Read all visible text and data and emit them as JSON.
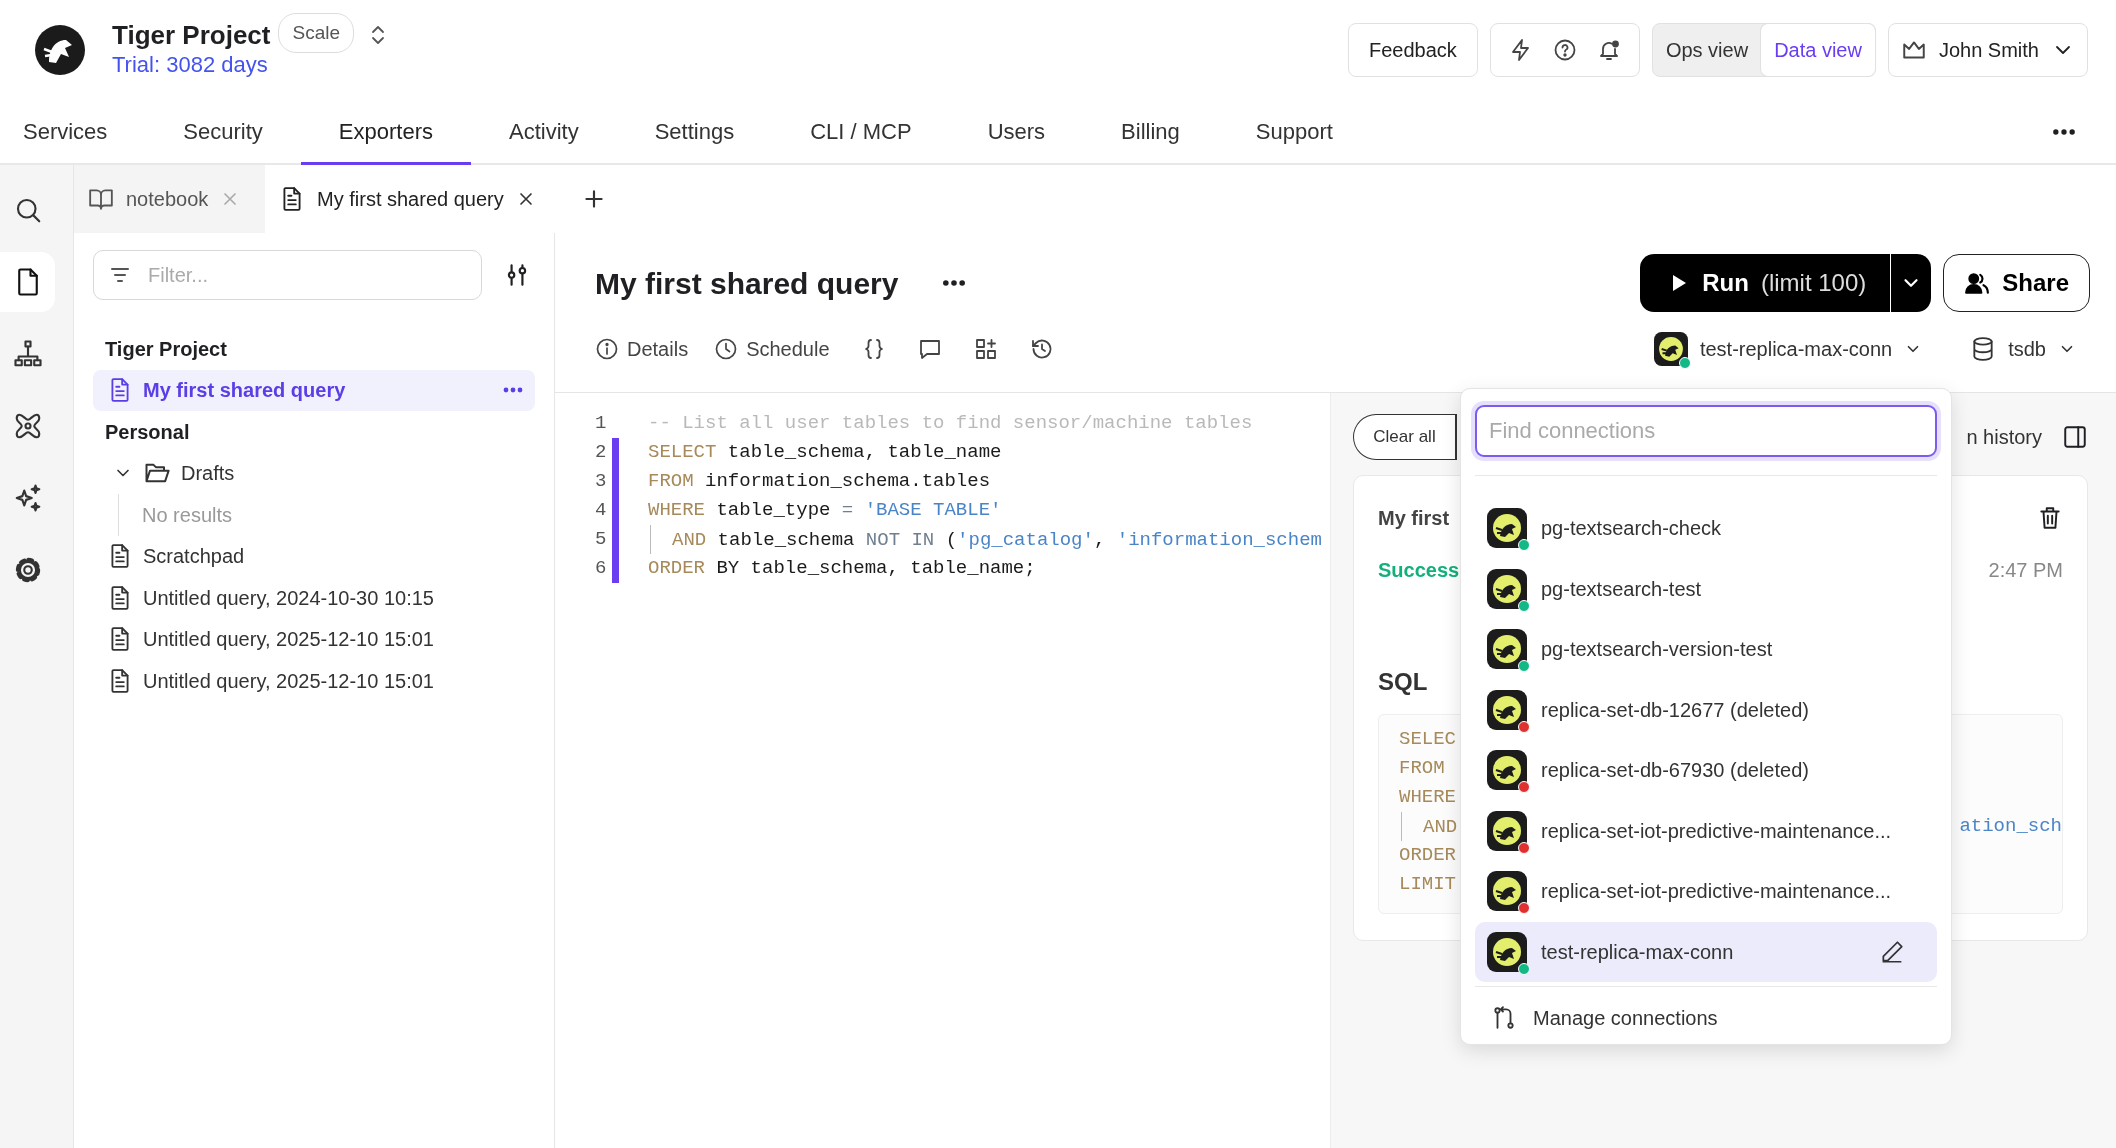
{
  "header": {
    "project": "Tiger Project",
    "trial": "Trial: 3082 days",
    "plan": "Scale",
    "feedback": "Feedback",
    "views": [
      {
        "label": "Ops view",
        "selected": false
      },
      {
        "label": "Data view",
        "selected": true
      }
    ],
    "user": "John Smith"
  },
  "nav": [
    {
      "label": "Services",
      "selected": false
    },
    {
      "label": "Security",
      "selected": false
    },
    {
      "label": "Exporters",
      "selected": true
    },
    {
      "label": "Activity",
      "selected": false
    },
    {
      "label": "Settings",
      "selected": false
    },
    {
      "label": "CLI / MCP",
      "selected": false
    },
    {
      "label": "Users",
      "selected": false
    },
    {
      "label": "Billing",
      "selected": false
    },
    {
      "label": "Support",
      "selected": false
    }
  ],
  "rail": [
    {
      "kind": "search",
      "selected": false
    },
    {
      "kind": "file",
      "selected": true
    },
    {
      "kind": "sitemap",
      "selected": false
    },
    {
      "kind": "atom",
      "selected": false
    },
    {
      "kind": "sparkles",
      "selected": false
    },
    {
      "kind": "gear",
      "selected": false
    }
  ],
  "tabs": [
    {
      "kind": "notebook",
      "label": "notebook",
      "selected": false
    },
    {
      "kind": "query",
      "label": "My first shared query",
      "selected": true
    }
  ],
  "sidebar": {
    "placeholder": "Filter...",
    "sections": [
      {
        "title": "Tiger Project",
        "items": [
          {
            "kind": "file",
            "label": "My first shared query",
            "selected": true
          }
        ]
      },
      {
        "title": "Personal",
        "items": [
          {
            "kind": "folder",
            "label": "Drafts",
            "expanded": true,
            "selected": false,
            "children": [
              {
                "kind": "empty",
                "label": "No results"
              }
            ]
          },
          {
            "kind": "file",
            "label": "Scratchpad",
            "selected": false
          },
          {
            "kind": "file",
            "label": "Untitled query, 2024-10-30 10:15",
            "selected": false
          },
          {
            "kind": "file",
            "label": "Untitled query, 2025-12-10 15:01",
            "selected": false
          },
          {
            "kind": "file",
            "label": "Untitled query, 2025-12-10 15:01",
            "selected": false
          }
        ]
      }
    ]
  },
  "query": {
    "title": "My first shared query",
    "run": "Run",
    "limit": "(limit 100)",
    "share": "Share",
    "toolbar": [
      {
        "kind": "info",
        "label": "Details"
      },
      {
        "kind": "clock",
        "label": "Schedule"
      },
      {
        "kind": "braces"
      },
      {
        "kind": "comment"
      },
      {
        "kind": "widgets"
      },
      {
        "kind": "history"
      }
    ],
    "connection": {
      "name": "test-replica-max-conn",
      "color": "#12b886"
    },
    "database": "tsdb"
  },
  "editor": {
    "lines": [
      {
        "number": "1",
        "modified": false,
        "guide": false,
        "tokens": [
          {
            "kind": "comment",
            "text": "-- List all user tables to find sensor/machine tables"
          }
        ]
      },
      {
        "number": "2",
        "modified": true,
        "guide": false,
        "tokens": [
          {
            "kind": "keyword",
            "text": "SELECT"
          },
          {
            "kind": "identifier",
            "text": " table_schema, table_name"
          }
        ]
      },
      {
        "number": "3",
        "modified": true,
        "guide": false,
        "tokens": [
          {
            "kind": "keyword",
            "text": "FROM"
          },
          {
            "kind": "identifier",
            "text": " information_schema.tables"
          }
        ]
      },
      {
        "number": "4",
        "modified": true,
        "guide": false,
        "tokens": [
          {
            "kind": "keyword",
            "text": "WHERE"
          },
          {
            "kind": "identifier",
            "text": " table_type "
          },
          {
            "kind": "operator",
            "text": "="
          },
          {
            "kind": "string",
            "text": " 'BASE TABLE'"
          }
        ]
      },
      {
        "number": "5",
        "modified": true,
        "guide": true,
        "tokens": [
          {
            "kind": "keyword",
            "text": "AND"
          },
          {
            "kind": "identifier",
            "text": " table_schema "
          },
          {
            "kind": "operator",
            "text": "NOT IN"
          },
          {
            "kind": "identifier",
            "text": " ("
          },
          {
            "kind": "string",
            "text": "'pg_catalog'"
          },
          {
            "kind": "identifier",
            "text": ", "
          },
          {
            "kind": "string",
            "text": "'information_schem"
          }
        ]
      },
      {
        "number": "6",
        "modified": true,
        "guide": false,
        "tokens": [
          {
            "kind": "keyword",
            "text": "ORDER"
          },
          {
            "kind": "identifier",
            "text": " BY table_schema, table_name;"
          }
        ]
      }
    ]
  },
  "results": {
    "clear": "Clear all",
    "history": "n history",
    "card": {
      "title": "My first",
      "status": "Success",
      "time": "2:47 PM",
      "sql_heading": "SQL",
      "lines": [
        {
          "guide": false,
          "tokens": [
            {
              "kind": "keyword",
              "text": "SELEC"
            }
          ]
        },
        {
          "guide": false,
          "tokens": [
            {
              "kind": "keyword",
              "text": "FROM"
            }
          ]
        },
        {
          "guide": false,
          "tokens": [
            {
              "kind": "keyword",
              "text": "WHERE"
            }
          ]
        },
        {
          "guide": true,
          "tokens": [
            {
              "kind": "keyword",
              "text": "AND"
            }
          ],
          "tail": {
            "kind": "string",
            "text": "ation_sch"
          }
        },
        {
          "guide": false,
          "tokens": [
            {
              "kind": "keyword",
              "text": "ORDER"
            }
          ]
        },
        {
          "guide": false,
          "tokens": [
            {
              "kind": "keyword",
              "text": "LIMIT"
            }
          ]
        }
      ]
    }
  },
  "dropdown": {
    "placeholder": "Find connections",
    "items": [
      {
        "name": "pg-textsearch-check",
        "color": "#12b886",
        "selected": false
      },
      {
        "name": "pg-textsearch-test",
        "color": "#12b886",
        "selected": false
      },
      {
        "name": "pg-textsearch-version-test",
        "color": "#12b886",
        "selected": false
      },
      {
        "name": "replica-set-db-12677 (deleted)",
        "color": "#e03131",
        "selected": false
      },
      {
        "name": "replica-set-db-67930 (deleted)",
        "color": "#e03131",
        "selected": false
      },
      {
        "name": "replica-set-iot-predictive-maintenance...",
        "color": "#e03131",
        "selected": false
      },
      {
        "name": "replica-set-iot-predictive-maintenance...",
        "color": "#e03131",
        "selected": false
      },
      {
        "name": "test-replica-max-conn",
        "color": "#12b886",
        "selected": true
      }
    ],
    "manage": "Manage connections"
  }
}
